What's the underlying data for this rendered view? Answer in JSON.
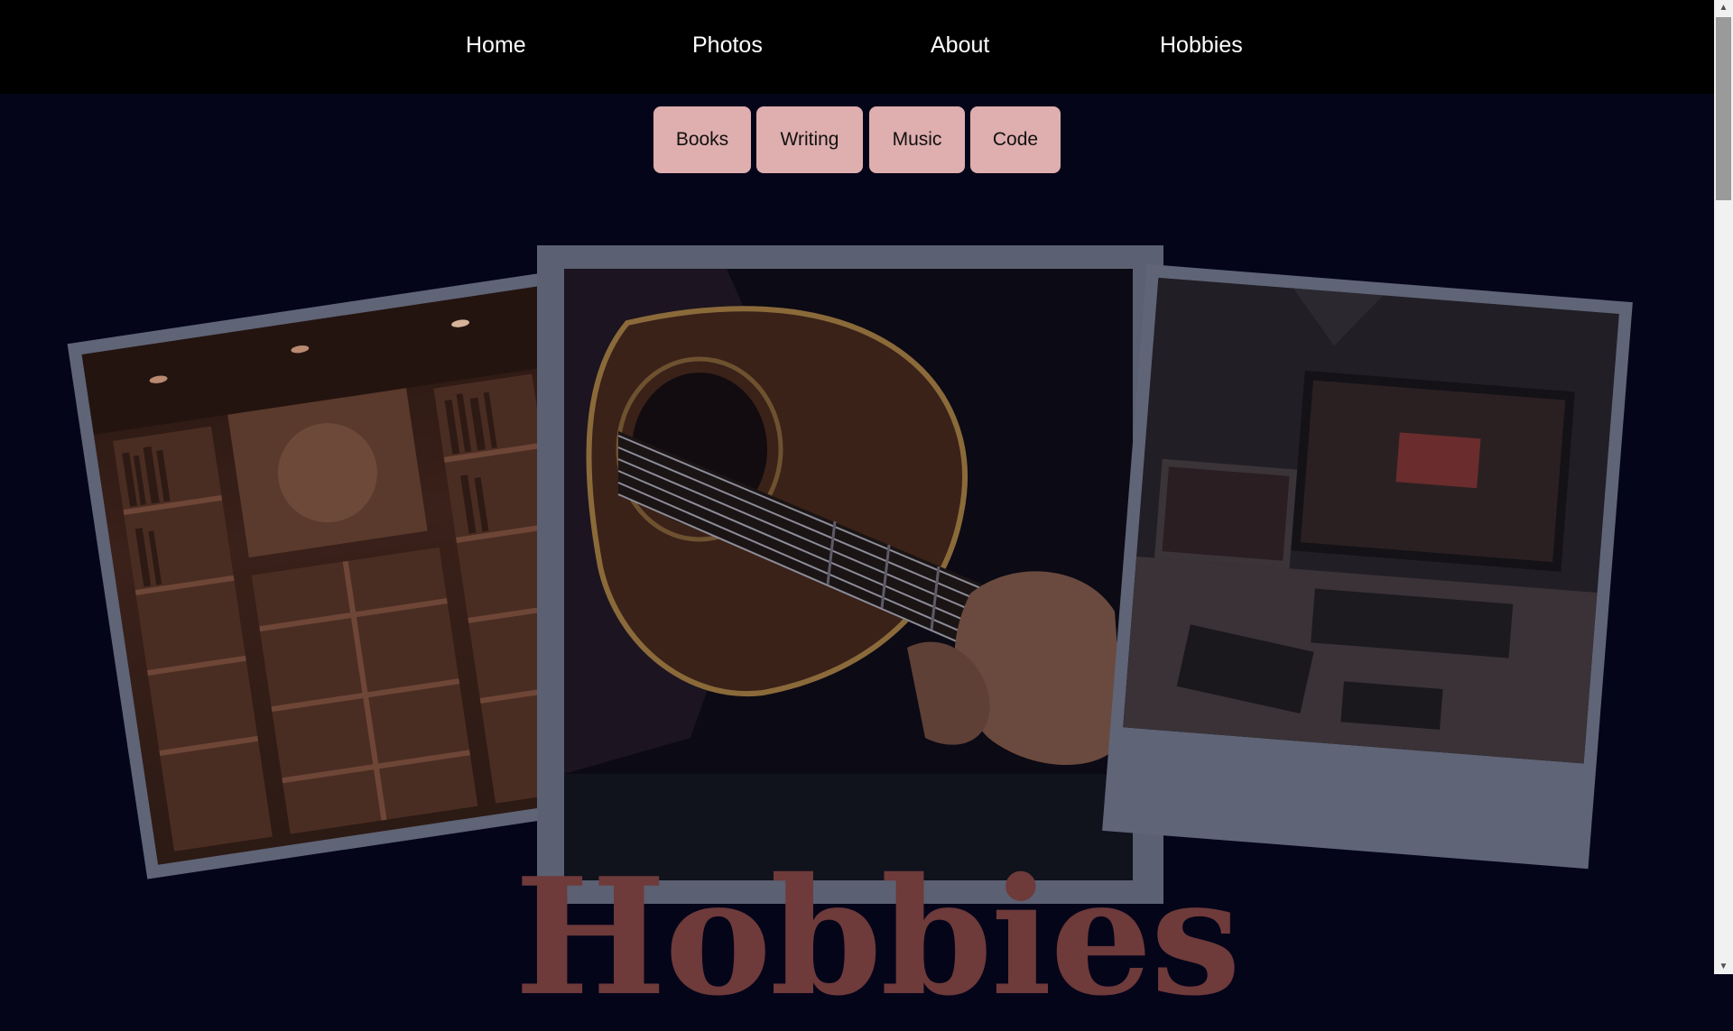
{
  "nav": {
    "items": [
      {
        "label": "Home"
      },
      {
        "label": "Photos"
      },
      {
        "label": "About"
      },
      {
        "label": "Hobbies"
      }
    ]
  },
  "subnav": {
    "buttons": [
      {
        "label": "Books"
      },
      {
        "label": "Writing"
      },
      {
        "label": "Music"
      },
      {
        "label": "Code"
      }
    ]
  },
  "hero": {
    "title": "Hobbies",
    "photos": [
      {
        "subject": "bookshelves"
      },
      {
        "subject": "acoustic guitar"
      },
      {
        "subject": "computer desk"
      }
    ]
  },
  "colors": {
    "background": "#05051a",
    "nav_background": "#000000",
    "button": "#dfaeae",
    "title": "#6e3a3a"
  },
  "icons": {
    "scroll_up": "triangle-up-icon",
    "scroll_down": "triangle-down-icon"
  }
}
